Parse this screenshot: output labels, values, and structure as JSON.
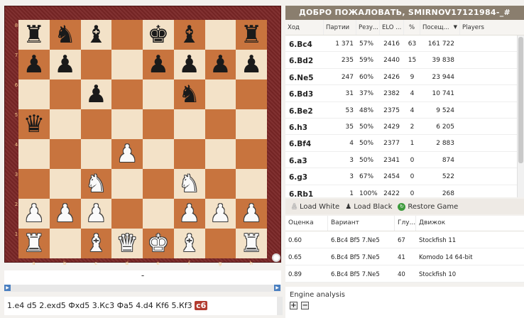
{
  "board": {
    "ranks": [
      "8",
      "7",
      "6",
      "5",
      "4",
      "3",
      "2",
      "1"
    ],
    "files": [
      "a",
      "b",
      "c",
      "d",
      "e",
      "f",
      "g",
      "h"
    ],
    "squares": [
      [
        "bR",
        "bN",
        "bB",
        "",
        "bK",
        "bB",
        "",
        "bR"
      ],
      [
        "bP",
        "bP",
        "",
        "",
        "bP",
        "bP",
        "bP",
        "bP"
      ],
      [
        "",
        "",
        "bP",
        "",
        "",
        "bN",
        "",
        ""
      ],
      [
        "bQ",
        "",
        "",
        "",
        "",
        "",
        "",
        ""
      ],
      [
        "",
        "",
        "",
        "wP",
        "",
        "",
        "",
        ""
      ],
      [
        "",
        "",
        "wN",
        "",
        "",
        "wN",
        "",
        ""
      ],
      [
        "wP",
        "wP",
        "wP",
        "",
        "",
        "wP",
        "wP",
        "wP"
      ],
      [
        "wR",
        "",
        "wB",
        "wQ",
        "wK",
        "wB",
        "",
        "wR"
      ]
    ]
  },
  "notation": {
    "header": "-",
    "moves": "1.e4 d5 2.exd5 Фxd5 3.Кc3 Фa5 4.d4 Кf6 5.Кf3",
    "current": "c6"
  },
  "welcome": "ДОБРО ПОЖАЛОВАТЬ, SMIRNOV17121984-_#",
  "move_table": {
    "headers": [
      "Ход",
      "Партии",
      "Резу...",
      "ELO ...",
      "%",
      "Посещ...",
      "Players"
    ],
    "rows": [
      {
        "move": "6.Bc4",
        "games": "1 371",
        "res": "57%",
        "elo": "2416",
        "pct": "63",
        "visits": "161 722"
      },
      {
        "move": "6.Bd2",
        "games": "235",
        "res": "59%",
        "elo": "2440",
        "pct": "15",
        "visits": "39 838"
      },
      {
        "move": "6.Ne5",
        "games": "247",
        "res": "60%",
        "elo": "2426",
        "pct": "9",
        "visits": "23 944"
      },
      {
        "move": "6.Bd3",
        "games": "31",
        "res": "37%",
        "elo": "2382",
        "pct": "4",
        "visits": "10 741"
      },
      {
        "move": "6.Be2",
        "games": "53",
        "res": "48%",
        "elo": "2375",
        "pct": "4",
        "visits": "9 524"
      },
      {
        "move": "6.h3",
        "games": "35",
        "res": "50%",
        "elo": "2429",
        "pct": "2",
        "visits": "6 205"
      },
      {
        "move": "6.Bf4",
        "games": "4",
        "res": "50%",
        "elo": "2377",
        "pct": "1",
        "visits": "2 883"
      },
      {
        "move": "6.a3",
        "games": "3",
        "res": "50%",
        "elo": "2341",
        "pct": "0",
        "visits": "874"
      },
      {
        "move": "6.g3",
        "games": "3",
        "res": "67%",
        "elo": "2454",
        "pct": "0",
        "visits": "522"
      },
      {
        "move": "6.Rb1",
        "games": "1",
        "res": "100%",
        "elo": "2422",
        "pct": "0",
        "visits": "268"
      }
    ]
  },
  "load_bar": {
    "load_white": "Load White",
    "load_black": "Load Black",
    "restore": "Restore Game"
  },
  "engine_table": {
    "headers": [
      "Оценка",
      "Вариант",
      "Глу...",
      "Движок"
    ],
    "rows": [
      {
        "score": "0.60",
        "line": "6.Bc4 Bf5 7.Ne5",
        "depth": "67",
        "engine": "Stockfish 11"
      },
      {
        "score": "0.65",
        "line": "6.Bc4 Bf5 7.Ne5",
        "depth": "41",
        "engine": "Komodo 14 64-bit"
      },
      {
        "score": "0.89",
        "line": "6.Bc4 Bf5 7.Ne5",
        "depth": "40",
        "engine": "Stockfish 10"
      }
    ]
  },
  "engine_analysis": {
    "title": "Engine analysis",
    "plus": "+",
    "minus": "−"
  },
  "colors": {
    "light_square": "#f3e2c8",
    "dark_square": "#c8743e",
    "frame": "#7a2626",
    "welcome_bar": "#8a7e6e",
    "current_move": "#b23b2f"
  }
}
